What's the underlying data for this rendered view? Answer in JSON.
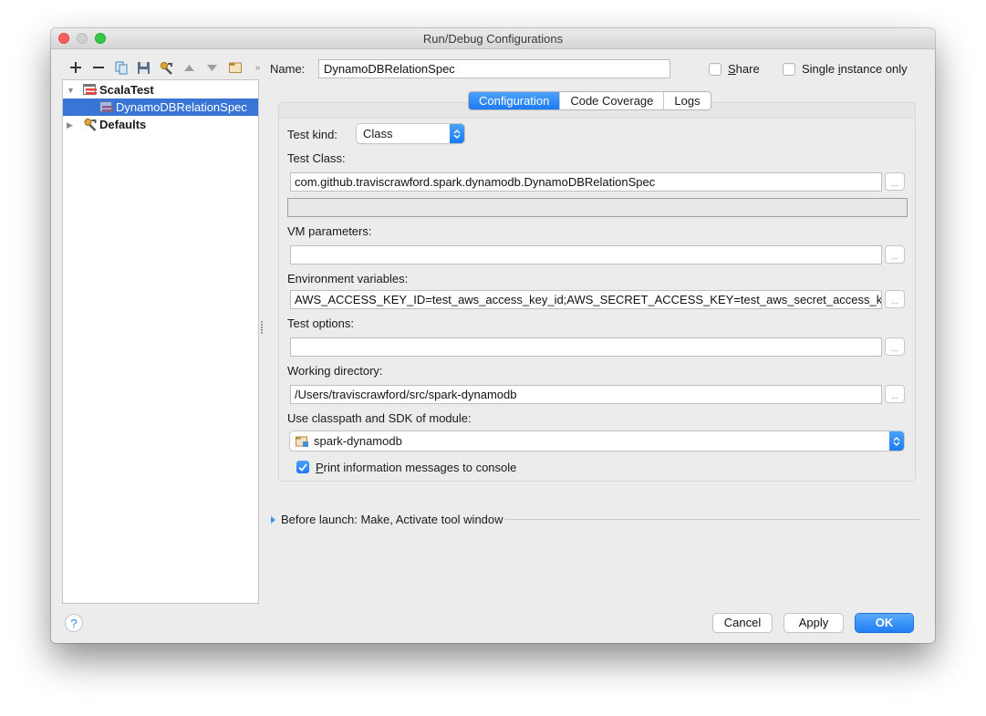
{
  "window": {
    "title": "Run/Debug Configurations"
  },
  "toolbar": {
    "items": [
      {
        "name": "add",
        "icon": "plus-icon"
      },
      {
        "name": "remove",
        "icon": "minus-icon"
      },
      {
        "name": "copy",
        "icon": "copy-icon"
      },
      {
        "name": "save",
        "icon": "save-icon"
      },
      {
        "name": "edit-defaults",
        "icon": "wrench-icon"
      },
      {
        "name": "move-up",
        "icon": "arrow-up-icon"
      },
      {
        "name": "move-down",
        "icon": "arrow-down-icon"
      },
      {
        "name": "folder",
        "icon": "folder-icon"
      },
      {
        "name": "more",
        "icon": "chevron-double-right-icon",
        "glyph": "»"
      }
    ]
  },
  "tree": {
    "items": [
      {
        "label": "ScalaTest",
        "expanded": true,
        "level": 0,
        "icon": "scalatest-icon"
      },
      {
        "label": "DynamoDBRelationSpec",
        "level": 1,
        "selected": true,
        "icon": "scalatest-config-icon"
      },
      {
        "label": "Defaults",
        "expanded": false,
        "level": 0,
        "icon": "defaults-wrench-icon"
      }
    ]
  },
  "header": {
    "name_label": "Name:",
    "name_value": "DynamoDBRelationSpec",
    "share_label_mnemonic": "S",
    "share_label_rest": "hare",
    "share_checked": false,
    "single_label_pre": "Single ",
    "single_label_mnemonic": "i",
    "single_label_rest": "nstance only",
    "single_checked": false
  },
  "tabs": [
    {
      "label": "Configuration",
      "active": true
    },
    {
      "label": "Code Coverage",
      "active": false
    },
    {
      "label": "Logs",
      "active": false
    }
  ],
  "config": {
    "test_kind_label": "Test kind:",
    "test_kind_value": "Class",
    "test_class_label": "Test Class:",
    "test_class_value": "com.github.traviscrawford.spark.dynamodb.DynamoDBRelationSpec",
    "vm_params_label": "VM parameters:",
    "vm_params_value": "",
    "env_vars_label": "Environment variables:",
    "env_vars_value": "AWS_ACCESS_KEY_ID=test_aws_access_key_id;AWS_SECRET_ACCESS_KEY=test_aws_secret_access_k",
    "test_options_label": "Test options:",
    "test_options_value": "",
    "working_dir_label": "Working directory:",
    "working_dir_value": "/Users/traviscrawford/src/spark-dynamodb",
    "module_label": "Use classpath and SDK of module:",
    "module_value": "spark-dynamodb",
    "print_info_mnemonic": "P",
    "print_info_rest": "rint information messages to console",
    "print_info_checked": true,
    "browse_label": "..."
  },
  "before_launch": {
    "label": "Before launch: Make, Activate tool window"
  },
  "footer": {
    "help_label": "?",
    "cancel_label": "Cancel",
    "apply_label": "Apply",
    "ok_label": "OK"
  },
  "colors": {
    "accent": "#1d7bf3",
    "selection": "#3875d7",
    "close": "#fc605c",
    "maximize": "#34c84a"
  }
}
